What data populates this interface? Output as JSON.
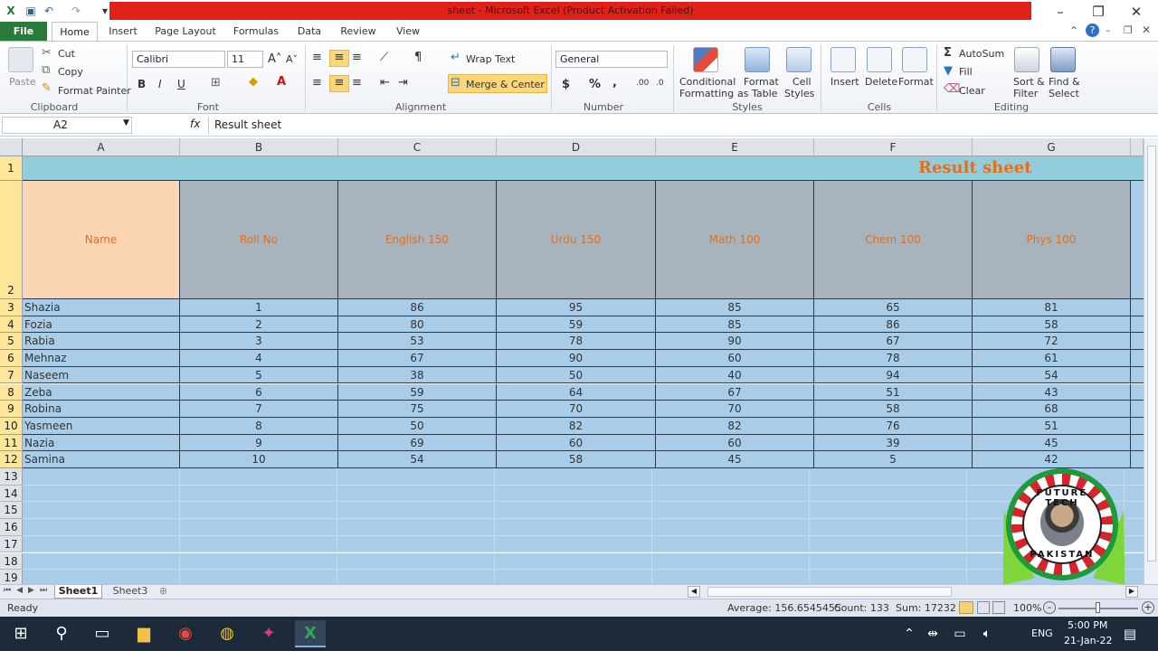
{
  "window": {
    "title": "sheet  -  Microsoft Excel (Product Activation Failed)"
  },
  "tabs": [
    "File",
    "Home",
    "Insert",
    "Page Layout",
    "Formulas",
    "Data",
    "Review",
    "View"
  ],
  "ribbon": {
    "clipboard": {
      "paste": "Paste",
      "cut": "Cut",
      "copy": "Copy",
      "format_painter": "Format Painter",
      "label": "Clipboard"
    },
    "font": {
      "name": "Calibri",
      "size": "11",
      "bold": "B",
      "italic": "I",
      "underline": "U",
      "label": "Font"
    },
    "alignment": {
      "wrap_text": "Wrap Text",
      "merge_center": "Merge & Center",
      "label": "Alignment"
    },
    "number": {
      "format": "General",
      "currency": "$",
      "percent": "%",
      "comma": ",",
      "label": "Number"
    },
    "styles": {
      "conditional": "Conditional",
      "conditional2": "Formatting",
      "format_table": "Format",
      "format_table2": "as Table",
      "cell_styles": "Cell",
      "cell_styles2": "Styles",
      "label": "Styles"
    },
    "cells": {
      "insert": "Insert",
      "delete": "Delete",
      "format": "Format",
      "label": "Cells"
    },
    "editing": {
      "autosum": "AutoSum",
      "fill": "Fill",
      "clear": "Clear",
      "sort": "Sort &",
      "sort2": "Filter",
      "find": "Find &",
      "find2": "Select",
      "label": "Editing"
    }
  },
  "formula_bar": {
    "name_box": "A2",
    "fx": "fx",
    "value": "Result sheet"
  },
  "sheet": {
    "columns": [
      "A",
      "B",
      "C",
      "D",
      "E",
      "F",
      "G"
    ],
    "title": "Result sheet",
    "headers": [
      "Name",
      "Roll No",
      "English 150",
      "Urdu 150",
      "Math 100",
      "Chem 100",
      "Phys 100"
    ],
    "rows": [
      [
        "Shazia",
        "1",
        "86",
        "95",
        "85",
        "65",
        "81"
      ],
      [
        "Fozia",
        "2",
        "80",
        "59",
        "85",
        "86",
        "58"
      ],
      [
        "Rabia",
        "3",
        "53",
        "78",
        "90",
        "67",
        "72"
      ],
      [
        "Mehnaz",
        "4",
        "67",
        "90",
        "60",
        "78",
        "61"
      ],
      [
        "Naseem",
        "5",
        "38",
        "50",
        "40",
        "94",
        "54"
      ],
      [
        "Zeba",
        "6",
        "59",
        "64",
        "67",
        "51",
        "43"
      ],
      [
        "Robina",
        "7",
        "75",
        "70",
        "70",
        "58",
        "68"
      ],
      [
        "Yasmeen",
        "8",
        "50",
        "82",
        "82",
        "76",
        "51"
      ],
      [
        "Nazia",
        "9",
        "69",
        "60",
        "60",
        "39",
        "45"
      ],
      [
        "Samina",
        "10",
        "54",
        "58",
        "45",
        "5",
        "42"
      ]
    ],
    "row_numbers": [
      "1",
      "2",
      "3",
      "4",
      "5",
      "6",
      "7",
      "8",
      "9",
      "10",
      "11",
      "12",
      "13",
      "14",
      "15",
      "16",
      "17",
      "18",
      "19"
    ]
  },
  "sheet_tabs": [
    "Sheet1",
    "Sheet3"
  ],
  "status": {
    "ready": "Ready",
    "average": "Average: 156.6545455",
    "count": "Count: 133",
    "sum": "Sum: 17232",
    "zoom": "100%"
  },
  "logo": {
    "top_text": "FUTURE TECH",
    "bottom_text": "PAKISTAN"
  },
  "taskbar": {
    "lang": "ENG",
    "time": "5:00 PM",
    "date": "21-Jan-22"
  },
  "colors": {
    "title_red": "#e0201a",
    "header_orange": "#e07020",
    "row_blue": "#a9cde8",
    "header_gray": "#a8b4bd",
    "name_peach": "#fcd5b4",
    "title_row": "#92cddc"
  }
}
